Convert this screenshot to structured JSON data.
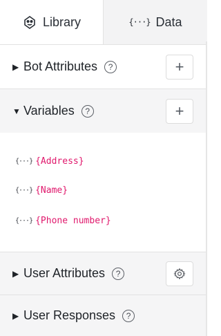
{
  "tabs": [
    {
      "label": "Library",
      "icon": "robot-head-icon"
    },
    {
      "label": "Data",
      "icon": "dots-braces-icon",
      "icon_text": "{···}"
    }
  ],
  "sections": {
    "bot_attributes": {
      "label": "Bot Attributes",
      "caret": "▶",
      "help": "?"
    },
    "variables": {
      "label": "Variables",
      "caret": "▼",
      "help": "?"
    },
    "user_attributes": {
      "label": "User Attributes",
      "caret": "▶",
      "help": "?"
    },
    "user_responses": {
      "label": "User Responses",
      "caret": "▶",
      "help": "?"
    }
  },
  "add_symbol": "+",
  "variables": [
    {
      "icon_text": "{···}",
      "name": "{Address}"
    },
    {
      "icon_text": "{···}",
      "name": "{Name}"
    },
    {
      "icon_text": "{···}",
      "name": "{Phone number}"
    }
  ],
  "colors": {
    "variable_text": "#e0186c",
    "gray_section": "#f5f5f6",
    "border": "#e2e2e2"
  }
}
